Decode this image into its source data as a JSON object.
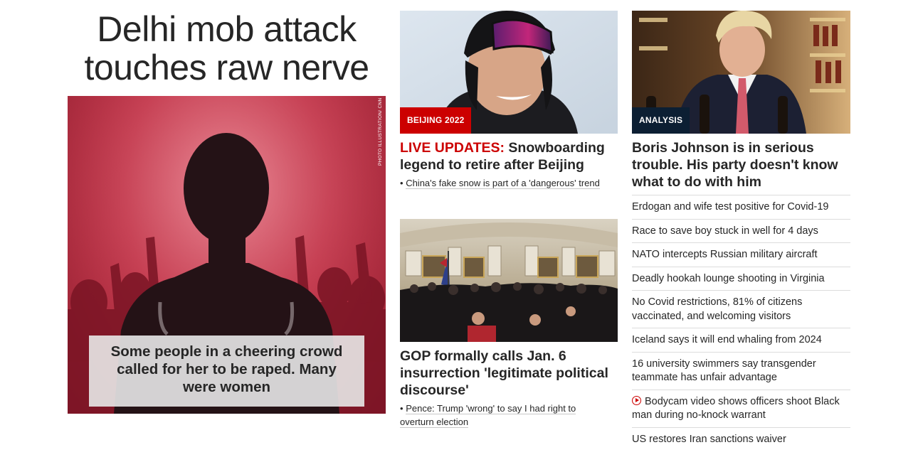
{
  "hero": {
    "title_line1": "Delhi mob attack",
    "title_line2": "touches raw nerve",
    "photo_credit": "PHOTO ILLUSTRATION/ CNN",
    "caption": "Some people in a cheering crowd called for her to be raped. Many were women"
  },
  "story_snowboard": {
    "badge": "BEIJING 2022",
    "live_label": "LIVE UPDATES:",
    "title": " Snowboarding legend to retire after Beijing",
    "related_bullet": "•",
    "related": "China's fake snow is part of a 'dangerous' trend"
  },
  "story_gop": {
    "title": "GOP formally calls Jan. 6 insurrection 'legitimate political discourse'",
    "related_bullet": "•",
    "related": "Pence: Trump 'wrong' to say I had right to overturn election"
  },
  "story_boris": {
    "badge": "ANALYSIS",
    "title": "Boris Johnson is in serious trouble. His party doesn't know what to do with him"
  },
  "headlines": [
    {
      "text": "Erdogan and wife test positive for Covid-19",
      "video": false
    },
    {
      "text": "Race to save boy stuck in well for 4 days",
      "video": false
    },
    {
      "text": "NATO intercepts Russian military aircraft",
      "video": false
    },
    {
      "text": "Deadly hookah lounge shooting in Virginia",
      "video": false
    },
    {
      "text": "No Covid restrictions, 81% of citizens vaccinated, and welcoming visitors",
      "video": false
    },
    {
      "text": "Iceland says it will end whaling from 2024",
      "video": false
    },
    {
      "text": "16 university swimmers say transgender teammate has unfair advantage",
      "video": false
    },
    {
      "text": "Bodycam video shows officers shoot Black man during no-knock warrant",
      "video": true
    },
    {
      "text": "US restores Iran sanctions waiver",
      "video": false
    }
  ],
  "colors": {
    "accent_red": "#cc0000",
    "analysis_navy": "#0c1f33",
    "text": "#262626"
  }
}
